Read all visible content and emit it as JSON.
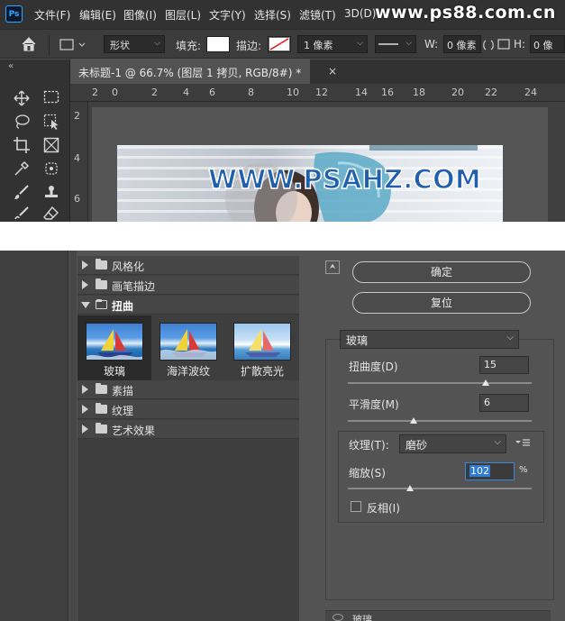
{
  "app": {
    "logo": "Ps",
    "watermark": "www.ps88.com.cn"
  },
  "menu": [
    "文件(F)",
    "编辑(E)",
    "图像(I)",
    "图层(L)",
    "文字(Y)",
    "选择(S)",
    "滤镜(T)",
    "3D(D)"
  ],
  "options_bar": {
    "mode": "形状",
    "fill_label": "填充:",
    "stroke_label": "描边:",
    "stroke_width": "1 像素",
    "w_label": "W:",
    "w_value": "0 像素",
    "h_label": "H:",
    "h_value": "0 像"
  },
  "document": {
    "tab_title": "未标题-1 @ 66.7% (图层 1 拷贝, RGB/8#) *",
    "close_glyph": "×",
    "image_text": "WWW.PSAHZ.COM"
  },
  "ruler": {
    "h_ticks": [
      "2",
      "0",
      "2",
      "4",
      "6",
      "8",
      "10",
      "12",
      "14",
      "16",
      "18",
      "20",
      "22",
      "24"
    ],
    "v_ticks": [
      "2",
      "4",
      "6"
    ]
  },
  "filter_gallery": {
    "categories": [
      {
        "label": "风格化",
        "open": false
      },
      {
        "label": "画笔描边",
        "open": false
      },
      {
        "label": "扭曲",
        "open": true
      },
      {
        "label": "素描",
        "open": false
      },
      {
        "label": "纹理",
        "open": false
      },
      {
        "label": "艺术效果",
        "open": false
      }
    ],
    "distort_filters": [
      {
        "label": "玻璃",
        "selected": true
      },
      {
        "label": "海洋波纹",
        "selected": false
      },
      {
        "label": "扩散亮光",
        "selected": false
      }
    ],
    "ok_label": "确定",
    "reset_label": "复位",
    "filter_select": "玻璃",
    "params": {
      "distortion_label": "扭曲度(D)",
      "distortion_value": "15",
      "distortion_fraction": 0.75,
      "smoothness_label": "平滑度(M)",
      "smoothness_value": "6",
      "smoothness_fraction": 0.36,
      "texture_label": "纹理(T):",
      "texture_value": "磨砂",
      "scale_label": "缩放(S)",
      "scale_value": "102",
      "scale_unit": "%",
      "scale_fraction": 0.34,
      "invert_label": "反相(I)",
      "invert_checked": false
    },
    "layer_row_label": "玻璃"
  }
}
